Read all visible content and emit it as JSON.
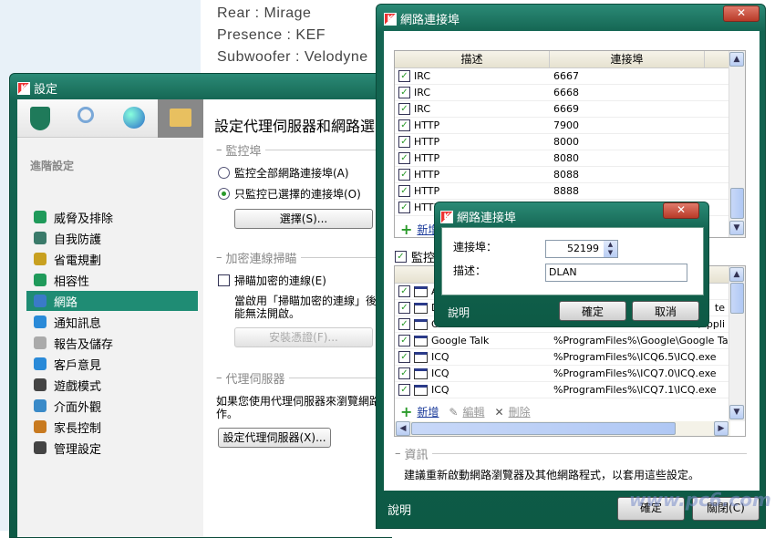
{
  "background": {
    "lines": [
      "Rear  : Mirage",
      "Presence : KEF",
      "Subwoofer : Velodyne"
    ]
  },
  "settings": {
    "title": "設定",
    "toolbar_icons": [
      "shield-icon",
      "search-icon",
      "globe-icon",
      "settings-folder-icon"
    ],
    "nav_header": "進階設定",
    "nav": [
      {
        "label": "威脅及排除",
        "icon": "check-circle-icon",
        "color": "#1f9a5a"
      },
      {
        "label": "自我防護",
        "icon": "kaspersky-shield-icon",
        "color": "#3a7a6a"
      },
      {
        "label": "省電規劃",
        "icon": "battery-icon",
        "color": "#c8a020"
      },
      {
        "label": "相容性",
        "icon": "checkbox-icon",
        "color": "#1f9a5a"
      },
      {
        "label": "網路",
        "icon": "network-icon",
        "color": "#3a7ac8",
        "selected": true
      },
      {
        "label": "通知訊息",
        "icon": "info-icon",
        "color": "#2a8ad8"
      },
      {
        "label": "報告及儲存",
        "icon": "report-icon",
        "color": "#aaa"
      },
      {
        "label": "客戶意見",
        "icon": "arrows-icon",
        "color": "#2a8ad8"
      },
      {
        "label": "遊戲模式",
        "icon": "gamepad-icon",
        "color": "#444"
      },
      {
        "label": "介面外觀",
        "icon": "window-icon",
        "color": "#3a8ac8"
      },
      {
        "label": "家長控制",
        "icon": "user-icon",
        "color": "#c87a20"
      },
      {
        "label": "管理設定",
        "icon": "floppy-icon",
        "color": "#444"
      }
    ],
    "heading": "設定代理伺服器和網路選",
    "monitor_ports": {
      "legend": "監控埠",
      "all_label": "監控全部網路連接埠(A)",
      "selected_label": "只監控已選擇的連接埠(O)",
      "selected": "selected",
      "select_button": "選擇(S)..."
    },
    "encrypted": {
      "legend": "加密連線掃瞄",
      "checkbox_label": "掃瞄加密的連線(E)",
      "checked": false,
      "desc1": "當啟用「掃瞄加密的連線」後",
      "desc2": "能無法開啟。",
      "install_button": "安裝憑證(F)..."
    },
    "proxy": {
      "legend": "代理伺服器",
      "desc1": "如果您使用代理伺服器來瀏覽網路",
      "desc2": "作。",
      "button": "設定代理伺服器(X)..."
    }
  },
  "ports_window": {
    "title": "網路連接埠",
    "ports_table": {
      "columns": [
        "描述",
        "連接埠"
      ],
      "rows": [
        {
          "name": "IRC",
          "port": "6667",
          "checked": true
        },
        {
          "name": "IRC",
          "port": "6668",
          "checked": true
        },
        {
          "name": "IRC",
          "port": "6669",
          "checked": true
        },
        {
          "name": "HTTP",
          "port": "7900",
          "checked": true
        },
        {
          "name": "HTTP",
          "port": "8000",
          "checked": true
        },
        {
          "name": "HTTP",
          "port": "8080",
          "checked": true
        },
        {
          "name": "HTTP",
          "port": "8088",
          "checked": true
        },
        {
          "name": "HTTP",
          "port": "8888",
          "checked": true
        },
        {
          "name": "HTTP",
          "port": "",
          "checked": true
        }
      ],
      "add_label": "新增"
    },
    "monitor_apps_label": "監控",
    "monitor_apps_checked": true,
    "apps_table": {
      "rows": [
        {
          "name": "A",
          "path": "",
          "checked": true
        },
        {
          "name": "D",
          "path": "te",
          "checked": true
        },
        {
          "name": "G",
          "path": "\\Appli",
          "checked": true
        },
        {
          "name": "Google Talk",
          "path": "%ProgramFiles%\\Google\\Google Talk\\googletalk.exe",
          "checked": true
        },
        {
          "name": "ICQ",
          "path": "%ProgramFiles%\\ICQ6.5\\ICQ.exe",
          "checked": true
        },
        {
          "name": "ICQ",
          "path": "%ProgramFiles%\\ICQ7.0\\ICQ.exe",
          "checked": true
        },
        {
          "name": "ICQ",
          "path": "%ProgramFiles%\\ICQ7.1\\ICQ.exe",
          "checked": true
        }
      ],
      "add_label": "新增",
      "edit_label": "編輯",
      "delete_label": "刪除"
    },
    "info": {
      "legend": "資訊",
      "text": "建議重新啟動網路瀏覽器及其他網路程式，以套用這些設定。"
    },
    "help": "說明",
    "ok": "確定",
    "close": "關閉(C)"
  },
  "dialog": {
    "title": "網路連接埠",
    "port_label": "連接埠：",
    "port_value": "52199",
    "desc_label": "描述：",
    "desc_value": "DLAN",
    "help": "說明",
    "ok": "確定",
    "cancel": "取消"
  },
  "watermark": "www.pc6.com"
}
